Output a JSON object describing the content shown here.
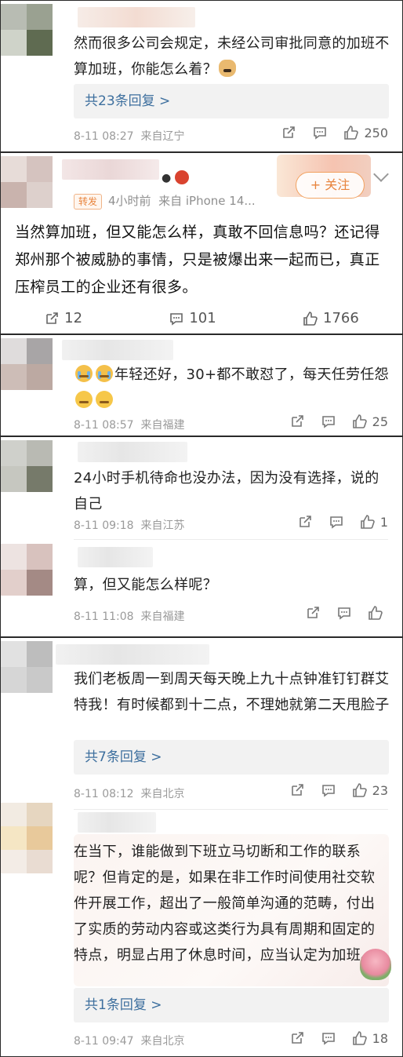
{
  "panel1": {
    "comment": {
      "text": "然而很多公司会规定，未经公司审批同意的加班不算加班，你能怎么着？",
      "reply_summary": "共23条回复 >",
      "date": "8-11 08:27",
      "location": "来自辽宁",
      "likes": "250"
    }
  },
  "panel2": {
    "badge": "转发",
    "time": "4小时前",
    "source": "来自 iPhone 14...",
    "follow_label": "+ 关注",
    "text": "当然算加班，但又能怎么样，真敢不回信息吗？还记得郑州那个被威胁的事情，只是被爆出来一起而已，真正压榨员工的企业还有很多。",
    "reposts": "12",
    "comments": "101",
    "likes": "1766"
  },
  "panel3": {
    "comment": {
      "text_after_emoji": "年轻还好，30+都不敢怼了，每天任劳任怨",
      "date": "8-11 08:57",
      "location": "来自福建",
      "likes": "25"
    }
  },
  "panel4": {
    "comments": [
      {
        "text": "24小时手机待命也没办法，因为没有选择，说的自己",
        "date": "8-11 09:18",
        "location": "来自江苏",
        "likes": "1"
      },
      {
        "text": "算，但又能怎么样呢？",
        "date": "8-11 11:08",
        "location": "来自福建",
        "likes": ""
      }
    ]
  },
  "panel5": {
    "comments": [
      {
        "text": "我们老板周一到周天每天晚上九十点钟准钉钉群艾特我！有时候都到十二点，不理她就第二天甩脸子",
        "reply_summary": "共7条回复 >",
        "date": "8-11 08:12",
        "location": "来自北京",
        "likes": "23"
      },
      {
        "text": "在当下，谁能做到下班立马切断和工作的联系呢？但肯定的是，如果在非工作时间使用社交软件开展工作，超出了一般简单沟通的范畴，付出了实质的劳动内容或这类行为具有周期和固定的特点，明显占用了休息时间，应当认定为加班。",
        "reply_summary": "共1条回复 >",
        "date": "8-11 09:47",
        "location": "来自北京",
        "likes": "18"
      }
    ]
  },
  "colors": {
    "link_blue": "#3d6f9e",
    "follow_orange": "#e8843d",
    "meta_gray": "#9a9a9a",
    "reply_bg": "#f2f2f2"
  }
}
